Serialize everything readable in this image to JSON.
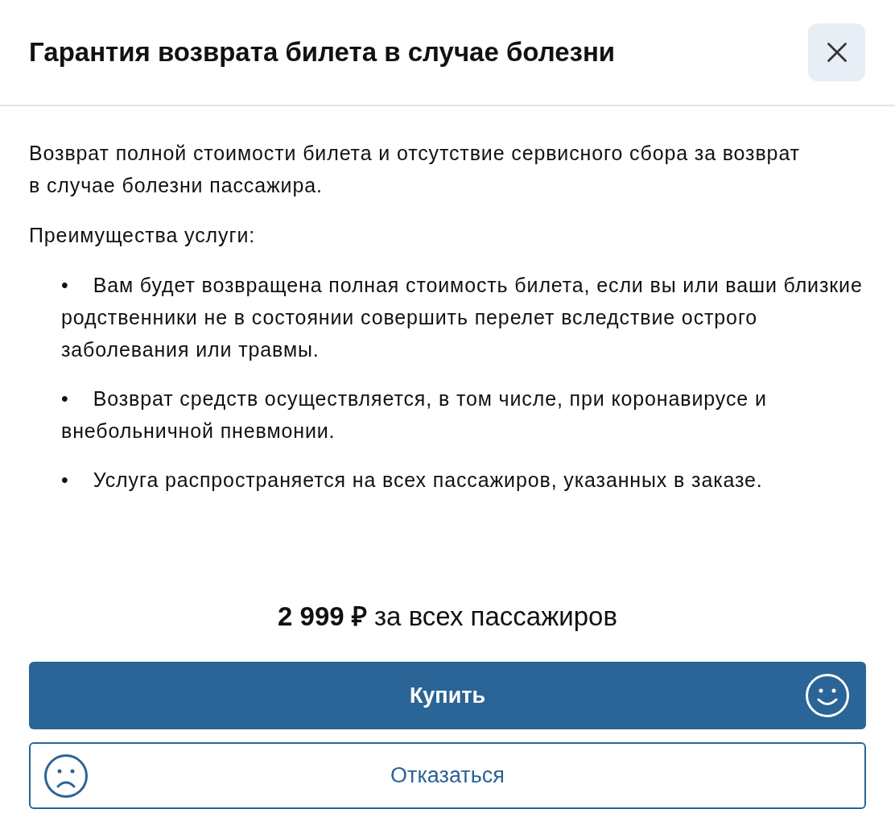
{
  "dialog": {
    "title": "Гарантия возврата билета в случае болезни"
  },
  "description": "Возврат полной стоимости билета и отсутствие сервисного сбора за возврат в случае болезни пассажира.",
  "benefits_heading": "Преимущества услуги:",
  "benefits": [
    {
      "bullet": "•",
      "text": "Вам будет возвращена полная стоимость билета, если вы или ваши близкие родственники не в состоянии совершить перелет вследствие острого заболевания или травмы."
    },
    {
      "bullet": "•",
      "text": "Возврат средств осуществляется, в том числе, при коронавирусе и внебольничной пневмонии."
    },
    {
      "bullet": "•",
      "text": "Услуга распространяется на всех пассажиров, указанных в заказе."
    }
  ],
  "price": "**2 999 ₽** за всех пассажиров",
  "buttons": [
    {
      "kind": "primary",
      "label": "Купить"
    },
    {
      "kind": "secondary",
      "label": "Отказаться"
    }
  ]
}
